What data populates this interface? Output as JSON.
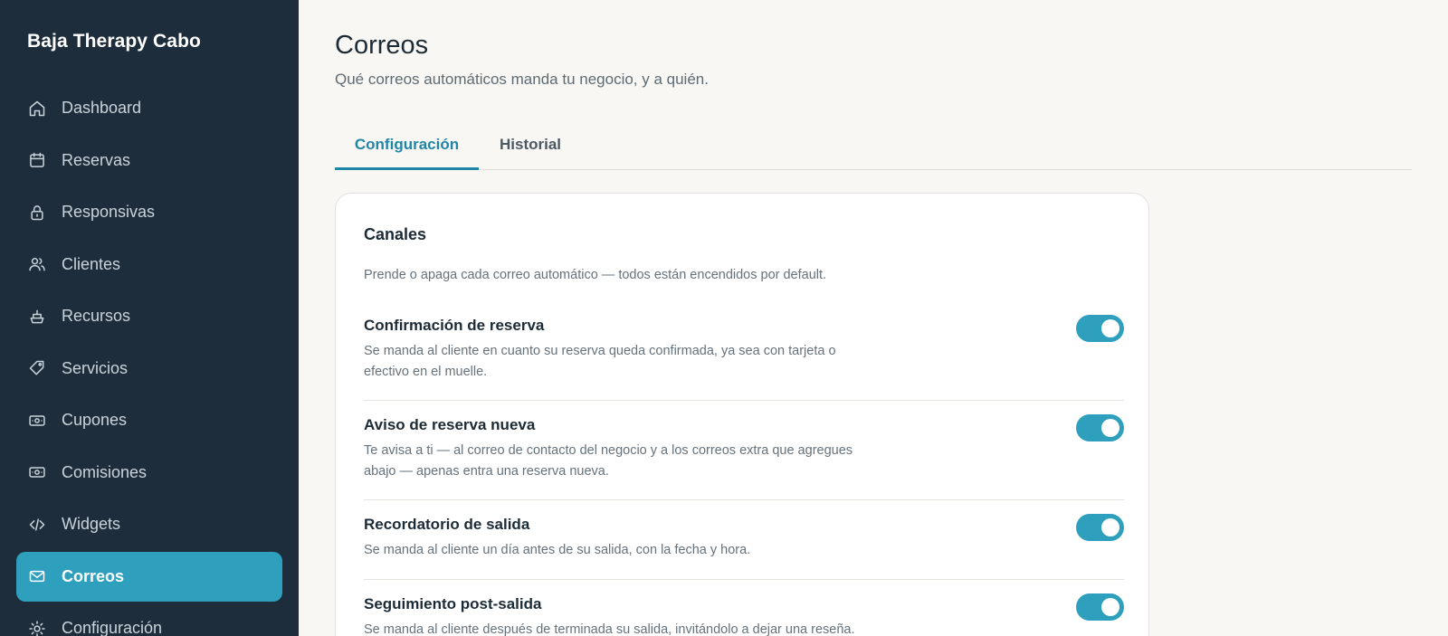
{
  "sidebar": {
    "brand": "Baja Therapy Cabo",
    "items": [
      {
        "label": "Dashboard",
        "icon": "home-icon"
      },
      {
        "label": "Reservas",
        "icon": "calendar-icon"
      },
      {
        "label": "Responsivas",
        "icon": "lock-icon"
      },
      {
        "label": "Clientes",
        "icon": "users-icon"
      },
      {
        "label": "Recursos",
        "icon": "boat-icon"
      },
      {
        "label": "Servicios",
        "icon": "tag-icon"
      },
      {
        "label": "Cupones",
        "icon": "banknote-icon"
      },
      {
        "label": "Comisiones",
        "icon": "banknote-icon"
      },
      {
        "label": "Widgets",
        "icon": "code-icon"
      },
      {
        "label": "Correos",
        "icon": "mail-icon",
        "active": true
      },
      {
        "label": "Configuración",
        "icon": "sun-icon"
      }
    ]
  },
  "header": {
    "title": "Correos",
    "subtitle": "Qué correos automáticos manda tu negocio, y a quién."
  },
  "tabs": [
    {
      "label": "Configuración",
      "active": true
    },
    {
      "label": "Historial",
      "active": false
    }
  ],
  "card": {
    "title": "Canales",
    "description": "Prende o apaga cada correo automático — todos están encendidos por default.",
    "channels": [
      {
        "title": "Confirmación de reserva",
        "description": "Se manda al cliente en cuanto su reserva queda confirmada, ya sea con tarjeta o efectivo en el muelle.",
        "enabled": true
      },
      {
        "title": "Aviso de reserva nueva",
        "description": "Te avisa a ti — al correo de contacto del negocio y a los correos extra que agregues abajo — apenas entra una reserva nueva.",
        "enabled": true
      },
      {
        "title": "Recordatorio de salida",
        "description": "Se manda al cliente un día antes de su salida, con la fecha y hora.",
        "enabled": true
      },
      {
        "title": "Seguimiento post-salida",
        "description": "Se manda al cliente después de terminada su salida, invitándolo a dejar una reseña.",
        "enabled": true
      }
    ]
  },
  "colors": {
    "sidebar_bg": "#1d2d3b",
    "accent": "#2e9fbd",
    "page_bg": "#f8f7f3"
  }
}
